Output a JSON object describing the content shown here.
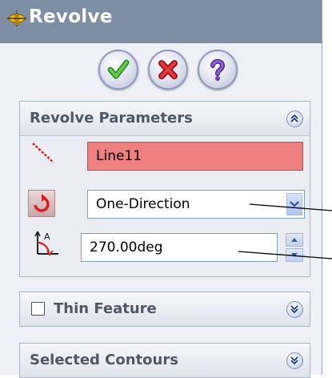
{
  "window": {
    "title": "Revolve",
    "icon": "revolve-feature-icon"
  },
  "actions": [
    {
      "name": "ok",
      "icon": "checkmark-icon",
      "color": "#3aa832"
    },
    {
      "name": "cancel",
      "icon": "x-icon",
      "color": "#d92b2b"
    },
    {
      "name": "help",
      "icon": "question-icon",
      "color": "#6f3fb0"
    }
  ],
  "revolve_parameters": {
    "header": "Revolve Parameters",
    "axis_value": "Line11",
    "direction_value": "One-Direction",
    "angle_value": "270.00deg",
    "icons": {
      "axis": "axis-of-revolution-icon",
      "reverse": "reverse-direction-icon",
      "angle": "angle-icon"
    }
  },
  "thin_feature": {
    "header": "Thin Feature",
    "checked": false
  },
  "selected_contours": {
    "header": "Selected Contours"
  },
  "colors": {
    "title_bar": "#7d8ea5",
    "error_field": "#f08080",
    "panel": "#eef0f5"
  }
}
